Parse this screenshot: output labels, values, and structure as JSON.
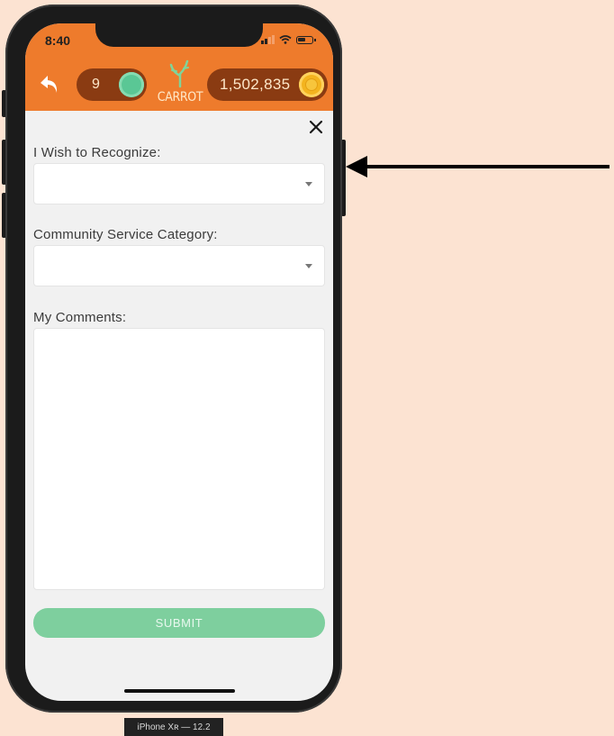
{
  "status_bar": {
    "time": "8:40"
  },
  "header": {
    "left_counter": "9",
    "logo_text": "CARROT",
    "right_counter": "1,502,835"
  },
  "form": {
    "field1_label": "I Wish to Recognize:",
    "field2_label": "Community Service Category:",
    "field3_label": "My Comments:",
    "submit_label": "SUBMIT"
  },
  "device_label": "iPhone Xʀ — 12.2",
  "colors": {
    "background": "#fce3d2",
    "header": "#ee7b2c",
    "pill": "#8a3b12",
    "submit": "#7ecf9e"
  },
  "icons": [
    "back-icon",
    "green-coin-icon",
    "carrot-logo-icon",
    "gold-coin-icon",
    "close-icon",
    "chevron-down-icon",
    "arrow-icon"
  ]
}
